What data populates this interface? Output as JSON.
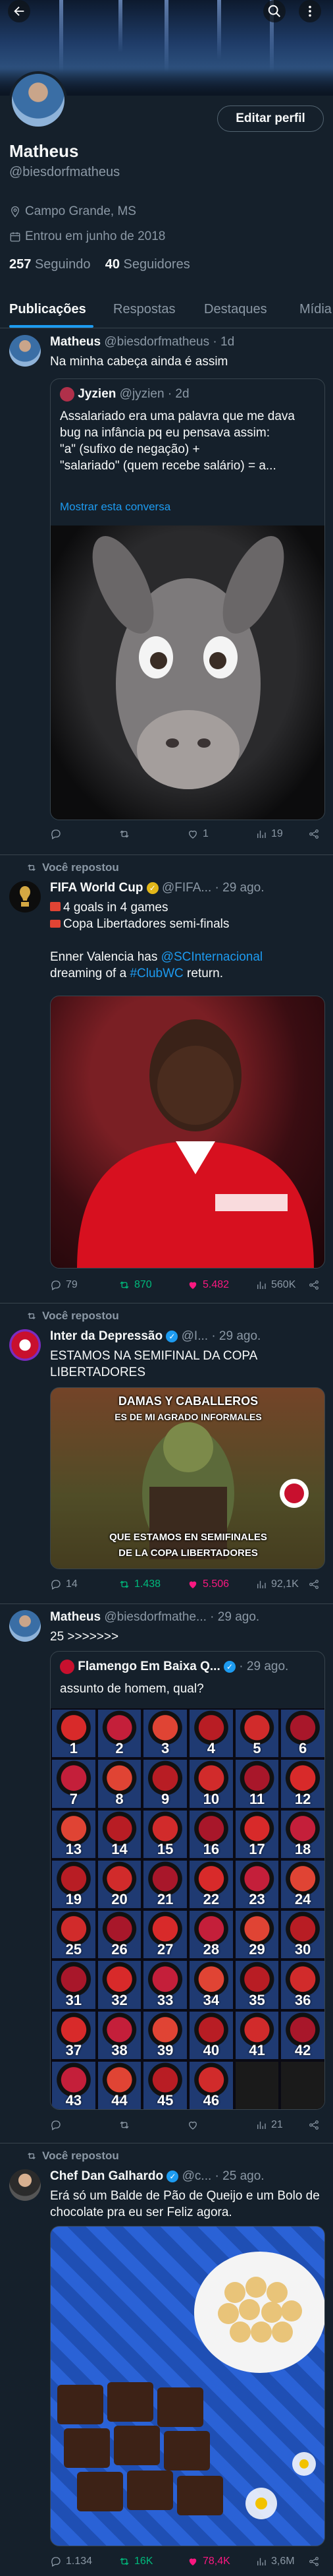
{
  "profile": {
    "name": "Matheus",
    "handle": "@biesdorfmatheus",
    "location": "Campo Grande, MS",
    "joined": "Entrou em junho de 2018",
    "following_count": "257",
    "following_label": "Seguindo",
    "followers_count": "40",
    "followers_label": "Seguidores",
    "edit_label": "Editar perfil"
  },
  "tabs": [
    "Publicações",
    "Respostas",
    "Destaques",
    "Mídia"
  ],
  "reposted_label": "Você repostou",
  "posts": [
    {
      "name": "Matheus",
      "handle": "@biesdorfmatheus",
      "time": "· 1d",
      "text": "Na minha cabeça ainda é assim",
      "quote": {
        "name": "Jyzien",
        "handle": "@jyzien",
        "time": "· 2d",
        "text1": "Assalariado era uma palavra que me dava bug na infância pq eu pensava assim:",
        "text2": "\"a\" (sufixo de negação) +",
        "text3": "\"salariado\" (quem recebe salário) = a...",
        "more": "Mostrar esta conversa"
      },
      "actions": {
        "replies": "",
        "reposts": "",
        "likes": "1",
        "views": "19"
      }
    },
    {
      "name": "FIFA World Cup",
      "handle": "@FIFA...",
      "time": "· 29 ago.",
      "line1": "4 goals in 4 games",
      "line2": "Copa Libertadores semi-finals",
      "line3_pre": "Enner Valencia has ",
      "line3_link": "@SCInternacional",
      "line4_pre": "dreaming of a ",
      "line4_link": "#ClubWC",
      "line4_post": " return.",
      "actions": {
        "replies": "79",
        "reposts": "870",
        "likes": "5.482",
        "views": "560K"
      }
    },
    {
      "name": "Inter da Depressão",
      "handle": "@I...",
      "time": "· 29 ago.",
      "text": "ESTAMOS NA SEMIFINAL DA COPA LIBERTADORES",
      "meme_top1": "DAMAS Y CABALLEROS",
      "meme_top2": "ES DE MI AGRADO INFORMALES",
      "meme_bot1": "QUE ESTAMOS EN SEMIFINALES",
      "meme_bot2": "DE LA COPA LIBERTADORES",
      "actions": {
        "replies": "14",
        "reposts": "1.438",
        "likes": "5.506",
        "views": "92,1K"
      }
    },
    {
      "name": "Matheus",
      "handle": "@biesdorfmathe...",
      "time": "· 29 ago.",
      "text": "25 >>>>>>>",
      "quote": {
        "name": "Flamengo Em Baixa Q...",
        "time": "· 29 ago.",
        "text": "assunto de homem, qual?"
      },
      "grid_numbers": [
        "1",
        "2",
        "3",
        "4",
        "5",
        "6",
        "7",
        "8",
        "9",
        "10",
        "11",
        "12",
        "13",
        "14",
        "15",
        "16",
        "17",
        "18",
        "19",
        "20",
        "21",
        "22",
        "23",
        "24",
        "25",
        "26",
        "27",
        "28",
        "29",
        "30",
        "31",
        "32",
        "33",
        "34",
        "35",
        "36",
        "37",
        "38",
        "39",
        "40",
        "41",
        "42",
        "43",
        "44",
        "45",
        "46"
      ],
      "actions": {
        "replies": "",
        "reposts": "",
        "likes": "",
        "views": "21"
      }
    },
    {
      "name": "Chef Dan Galhardo",
      "handle": "@c...",
      "time": "· 25 ago.",
      "text": "Erá só um Balde de Pão de Queijo e um Bolo de chocolate pra eu ser Feliz agora.",
      "actions": {
        "replies": "1.134",
        "reposts": "16K",
        "likes": "78,4K",
        "views": "3,6M"
      }
    }
  ],
  "colors": {
    "bg": "#15202b",
    "accent": "#1d9bf0",
    "muted": "#8b98a5",
    "repost_green": "#00ba7c",
    "like_pink": "#f91880"
  }
}
